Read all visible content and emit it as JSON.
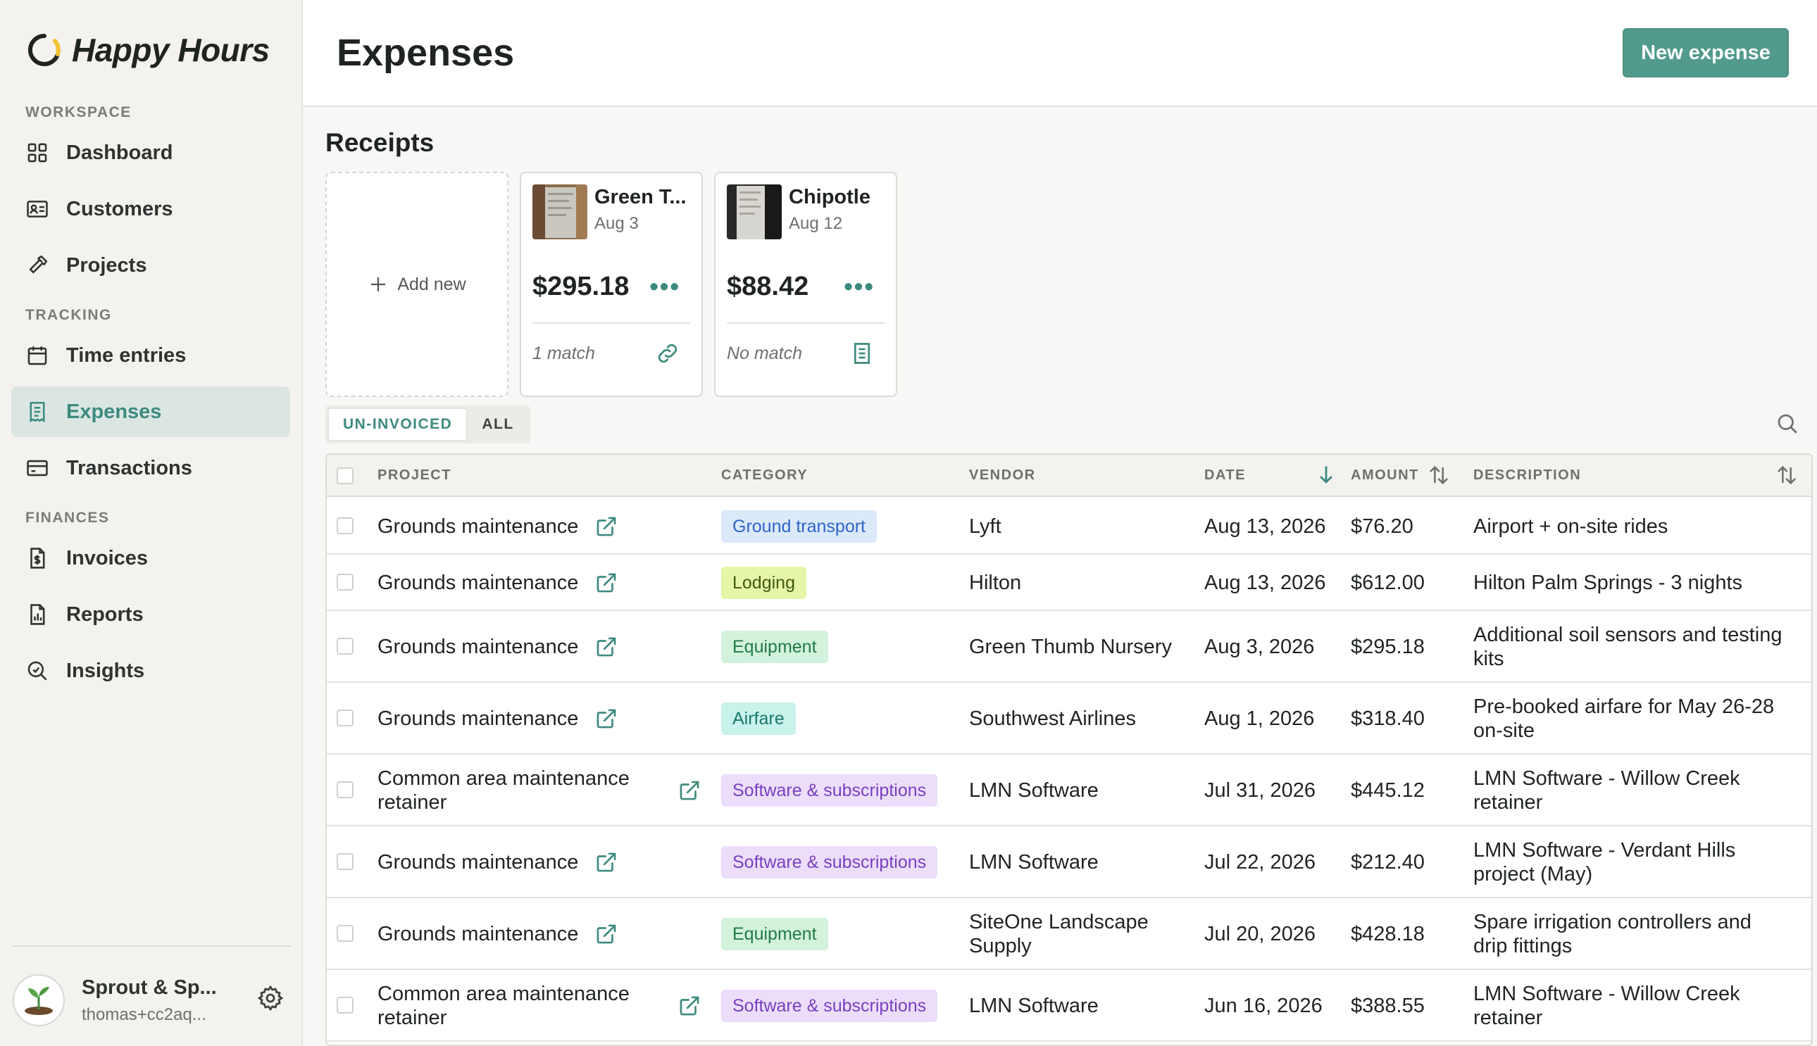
{
  "app": {
    "name": "Happy Hours"
  },
  "sidebar": {
    "sections": [
      {
        "label": "WORKSPACE",
        "items": [
          {
            "label": "Dashboard",
            "icon": "dashboard-grid-icon"
          },
          {
            "label": "Customers",
            "icon": "contact-card-icon"
          },
          {
            "label": "Projects",
            "icon": "hammer-icon"
          }
        ]
      },
      {
        "label": "TRACKING",
        "items": [
          {
            "label": "Time entries",
            "icon": "calendar-icon"
          },
          {
            "label": "Expenses",
            "icon": "receipt-icon",
            "active": true
          },
          {
            "label": "Transactions",
            "icon": "credit-card-icon"
          }
        ]
      },
      {
        "label": "FINANCES",
        "items": [
          {
            "label": "Invoices",
            "icon": "invoice-dollar-icon"
          },
          {
            "label": "Reports",
            "icon": "report-icon"
          },
          {
            "label": "Insights",
            "icon": "insights-magnifier-icon"
          }
        ]
      }
    ],
    "account": {
      "name": "Sprout & Sp...",
      "email": "thomas+cc2aq..."
    }
  },
  "header": {
    "title": "Expenses",
    "new_button": "New expense"
  },
  "receipts": {
    "title": "Receipts",
    "add_label": "Add new",
    "cards": [
      {
        "vendor": "Green T...",
        "date": "Aug 3",
        "amount": "$295.18",
        "match": "1 match",
        "status_icon": "link-icon"
      },
      {
        "vendor": "Chipotle",
        "date": "Aug 12",
        "amount": "$88.42",
        "match": "No match",
        "status_icon": "receipt-doc-icon"
      }
    ]
  },
  "filters": {
    "tabs": [
      {
        "label": "UN-INVOICED",
        "active": true
      },
      {
        "label": "ALL",
        "active": false
      }
    ]
  },
  "table": {
    "headers": {
      "project": "PROJECT",
      "category": "CATEGORY",
      "vendor": "VENDOR",
      "date": "DATE",
      "amount": "AMOUNT",
      "description": "DESCRIPTION"
    },
    "rows": [
      {
        "project": "Grounds maintenance",
        "category": "Ground transport",
        "category_color": "blue",
        "vendor": "Lyft",
        "date": "Aug 13, 2026",
        "amount": "$76.20",
        "description": "Airport + on-site rides"
      },
      {
        "project": "Grounds maintenance",
        "category": "Lodging",
        "category_color": "lime",
        "vendor": "Hilton",
        "date": "Aug 13, 2026",
        "amount": "$612.00",
        "description": "Hilton Palm Springs - 3 nights"
      },
      {
        "project": "Grounds maintenance",
        "category": "Equipment",
        "category_color": "green",
        "vendor": "Green Thumb Nursery",
        "date": "Aug 3, 2026",
        "amount": "$295.18",
        "description": "Additional soil sensors and testing kits"
      },
      {
        "project": "Grounds maintenance",
        "category": "Airfare",
        "category_color": "teal",
        "vendor": "Southwest Airlines",
        "date": "Aug 1, 2026",
        "amount": "$318.40",
        "description": "Pre-booked airfare for May 26-28 on-site"
      },
      {
        "project": "Common area maintenance retainer",
        "category": "Software & subscriptions",
        "category_color": "purple",
        "vendor": "LMN Software",
        "date": "Jul 31, 2026",
        "amount": "$445.12",
        "description": "LMN Software - Willow Creek retainer"
      },
      {
        "project": "Grounds maintenance",
        "category": "Software & subscriptions",
        "category_color": "purple",
        "vendor": "LMN Software",
        "date": "Jul 22, 2026",
        "amount": "$212.40",
        "description": "LMN Software - Verdant Hills project (May)"
      },
      {
        "project": "Grounds maintenance",
        "category": "Equipment",
        "category_color": "green",
        "vendor": "SiteOne Landscape Supply",
        "date": "Jul 20, 2026",
        "amount": "$428.18",
        "description": "Spare irrigation controllers and drip fittings"
      },
      {
        "project": "Common area maintenance retainer",
        "category": "Software & subscriptions",
        "category_color": "purple",
        "vendor": "LMN Software",
        "date": "Jun 16, 2026",
        "amount": "$388.55",
        "description": "LMN Software - Willow Creek retainer"
      }
    ]
  },
  "colors": {
    "accent": "#519a8c",
    "accent_text": "#3c8a7e",
    "pill_blue_bg": "#dbe9fb",
    "pill_blue_fg": "#2f64c8",
    "pill_lime_bg": "#e5f6a8",
    "pill_lime_fg": "#3f5a12",
    "pill_green_bg": "#d3f2dc",
    "pill_green_fg": "#217a45",
    "pill_teal_bg": "#c8f2ea",
    "pill_teal_fg": "#1a7a6c",
    "pill_purple_bg": "#ecdefb",
    "pill_purple_fg": "#7a3fc0"
  }
}
